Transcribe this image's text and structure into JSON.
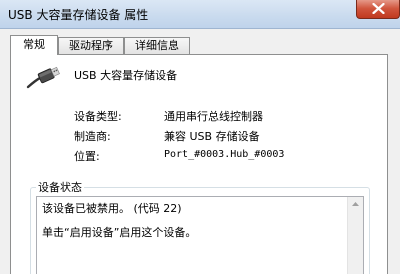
{
  "window": {
    "title": "USB 大容量存储设备 属性",
    "close_icon": "close-icon"
  },
  "tabs": [
    {
      "label": "常规",
      "active": true
    },
    {
      "label": "驱动程序",
      "active": false
    },
    {
      "label": "详细信息",
      "active": false
    }
  ],
  "device": {
    "icon": "usb-plug-icon",
    "name": "USB 大容量存储设备"
  },
  "properties": {
    "type_label": "设备类型:",
    "type_value": "通用串行总线控制器",
    "manufacturer_label": "制造商:",
    "manufacturer_value": "兼容 USB 存储设备",
    "location_label": "位置:",
    "location_value": "Port_#0003.Hub_#0003"
  },
  "status": {
    "group_title": "设备状态",
    "line1": "该设备已被禁用。 (代码 22)",
    "line2": "单击“启用设备”启用这个设备。"
  }
}
